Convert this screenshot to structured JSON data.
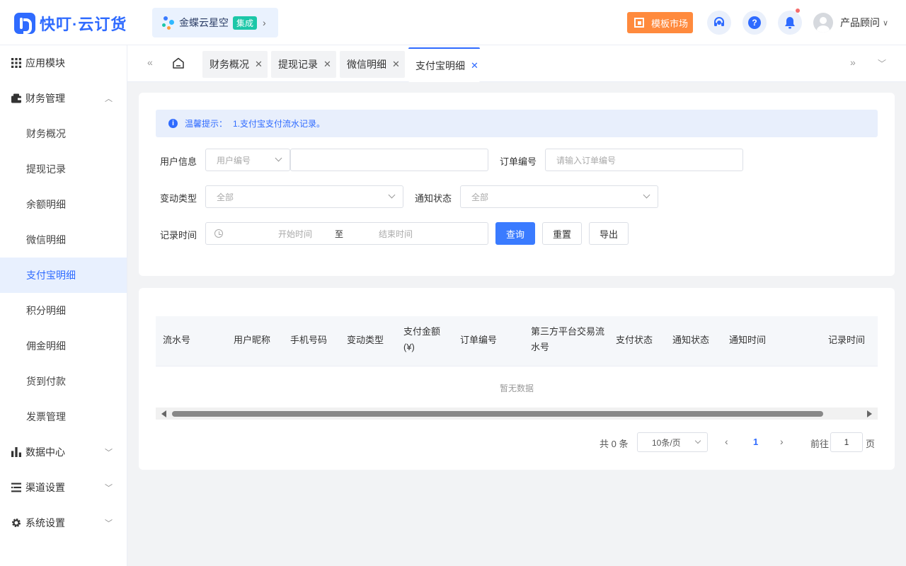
{
  "header": {
    "logo_text": "快叮·云订货",
    "integration": {
      "name": "金蝶云星空",
      "badge": "集成",
      "arrow": "›"
    },
    "template_market": "模板市场",
    "help_glyph": "?",
    "user_name": "产品顾问",
    "user_caret": "∨"
  },
  "sidebar": {
    "groups": [
      {
        "label": "应用模块",
        "icon": "grid-icon"
      },
      {
        "label": "财务管理",
        "icon": "wallet-icon",
        "expanded": true
      },
      {
        "label": "数据中心",
        "icon": "bar-chart-icon"
      },
      {
        "label": "渠道设置",
        "icon": "list-icon"
      },
      {
        "label": "系统设置",
        "icon": "gear-icon"
      }
    ],
    "items": [
      {
        "label": "财务概况"
      },
      {
        "label": "提现记录"
      },
      {
        "label": "余额明细"
      },
      {
        "label": "微信明细"
      },
      {
        "label": "支付宝明细",
        "active": true
      },
      {
        "label": "积分明细"
      },
      {
        "label": "佣金明细"
      },
      {
        "label": "货到付款"
      },
      {
        "label": "发票管理"
      }
    ]
  },
  "tabs": [
    {
      "label": "财务概况"
    },
    {
      "label": "提现记录"
    },
    {
      "label": "微信明细"
    },
    {
      "label": "支付宝明细",
      "active": true
    }
  ],
  "notice": {
    "title": "温馨提示：",
    "text": "1.支付宝支付流水记录。"
  },
  "filters": {
    "user_info_label": "用户信息",
    "user_info_select": "用户编号",
    "user_info_value": "",
    "order_no_label": "订单编号",
    "order_no_placeholder": "请输入订单编号",
    "change_type_label": "变动类型",
    "change_type_value": "全部",
    "notify_status_label": "通知状态",
    "notify_status_value": "全部",
    "record_time_label": "记录时间",
    "start_placeholder": "开始时间",
    "range_sep": "至",
    "end_placeholder": "结束时间",
    "query_button": "查询",
    "reset_button": "重置",
    "export_button": "导出"
  },
  "table": {
    "columns": [
      {
        "line1": "流水号",
        "line2": ""
      },
      {
        "line1": "用户昵称",
        "line2": ""
      },
      {
        "line1": "手机号码",
        "line2": ""
      },
      {
        "line1": "变动类型",
        "line2": ""
      },
      {
        "line1": "支付金额",
        "line2": "(¥)"
      },
      {
        "line1": "订单编号",
        "line2": ""
      },
      {
        "line1": "第三方平台交易流",
        "line2": "水号"
      },
      {
        "line1": "支付状态",
        "line2": ""
      },
      {
        "line1": "通知状态",
        "line2": ""
      },
      {
        "line1": "通知时间",
        "line2": ""
      },
      {
        "line1": "记录时间",
        "line2": ""
      }
    ],
    "empty_text": "暂无数据"
  },
  "pagination": {
    "total_text": "共 0 条",
    "page_size": "10条/页",
    "current_page": "1",
    "goto_label": "前往",
    "goto_value": "1",
    "page_unit": "页"
  },
  "colors": {
    "primary": "#2f6bff",
    "accent": "#ff8a3d",
    "badge": "#1cc7a8"
  }
}
